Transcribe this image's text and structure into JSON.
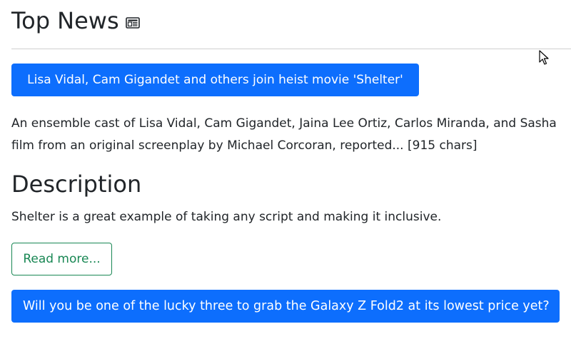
{
  "header": {
    "title": "Top News",
    "icon": "newspaper-icon"
  },
  "articles": [
    {
      "headline": "Lisa Vidal, Cam Gigandet and others join heist movie 'Shelter'",
      "snippet_line1": "An ensemble cast of Lisa Vidal, Cam Gigandet, Jaina Lee Ortiz, Carlos Miranda, and Sasha",
      "snippet_line2": "film from an original screenplay by Michael Corcoran, reported... [915 chars]",
      "section_title": "Description",
      "description": "Shelter is a great example of taking any script and making it inclusive.",
      "read_more_label": "Read more..."
    },
    {
      "headline": "Will you be one of the lucky three to grab the Galaxy Z Fold2 at its lowest price yet?"
    }
  ],
  "colors": {
    "primary": "#0d6efd",
    "success": "#198754",
    "text": "#212529",
    "divider": "#cfcfcf"
  }
}
